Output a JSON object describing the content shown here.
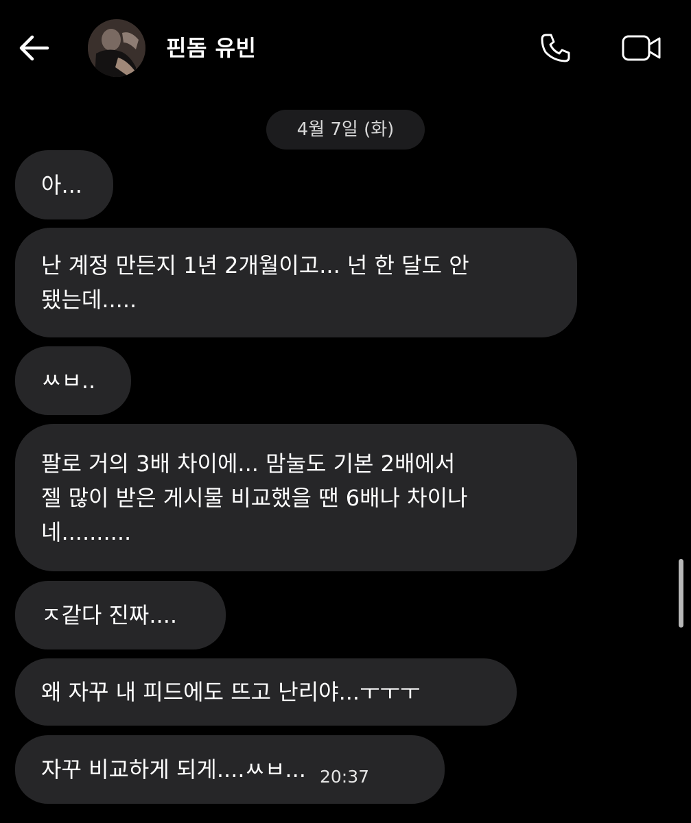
{
  "header": {
    "contact_name": "핀돔 유빈"
  },
  "icons": {
    "back": "arrow-left-icon",
    "call": "phone-icon",
    "video": "video-camera-icon"
  },
  "date_separator": "4월 7일 (화)",
  "messages": [
    {
      "text": "아..."
    },
    {
      "text": "난 계정 만든지 1년 2개월이고... 넌 한 달도 안\n됐는데....."
    },
    {
      "text": "ㅆㅂ.."
    },
    {
      "text": "팔로 거의 3배 차이에... 맘눌도 기본 2배에서\n젤 많이 받은 게시물 비교했을 땐 6배나 차이나\n네.........."
    },
    {
      "text": "ㅈ같다 진짜...."
    },
    {
      "text": "왜 자꾸 내 피드에도 뜨고 난리야...ㅜㅜㅜ"
    },
    {
      "text": "자꾸 비교하게 되게....ㅆㅂ...",
      "time": "20:37"
    }
  ],
  "colors": {
    "background": "#000000",
    "bubble": "#262628",
    "date_chip": "#1c1c1e",
    "text": "#ffffff"
  }
}
